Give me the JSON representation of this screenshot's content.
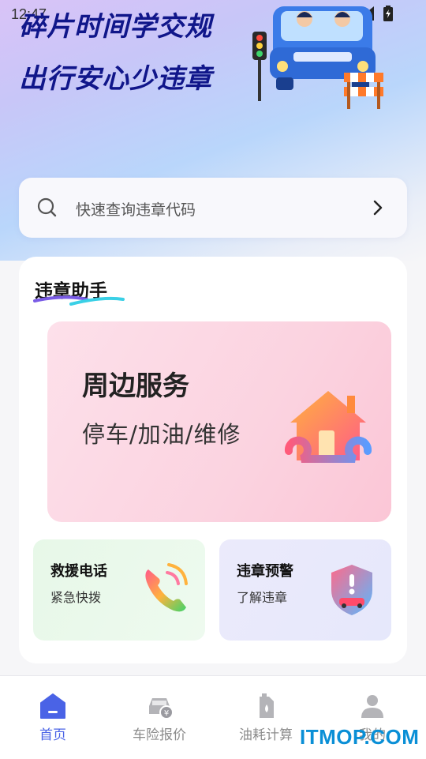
{
  "status_bar": {
    "time": "12:47"
  },
  "hero": {
    "line1": "碎片时间学交规",
    "line2": "出行安心少违章"
  },
  "search": {
    "placeholder": "快速查询违章代码"
  },
  "panel": {
    "title": "违章助手",
    "service_card": {
      "title": "周边服务",
      "subtitle": "停车/加油/维修"
    },
    "rescue_card": {
      "title": "救援电话",
      "subtitle": "紧急快拨"
    },
    "warning_card": {
      "title": "违章预警",
      "subtitle": "了解违章"
    }
  },
  "tabs": [
    {
      "label": "首页",
      "icon": "home-icon",
      "active": true
    },
    {
      "label": "车险报价",
      "icon": "car-insurance-icon",
      "active": false
    },
    {
      "label": "油耗计算",
      "icon": "fuel-icon",
      "active": false
    },
    {
      "label": "我的",
      "icon": "profile-icon",
      "active": false
    }
  ],
  "watermark": "ITMOP.COM",
  "colors": {
    "accent": "#4a63e6",
    "slogan": "#10168a",
    "watermark": "#0a8fd6"
  }
}
